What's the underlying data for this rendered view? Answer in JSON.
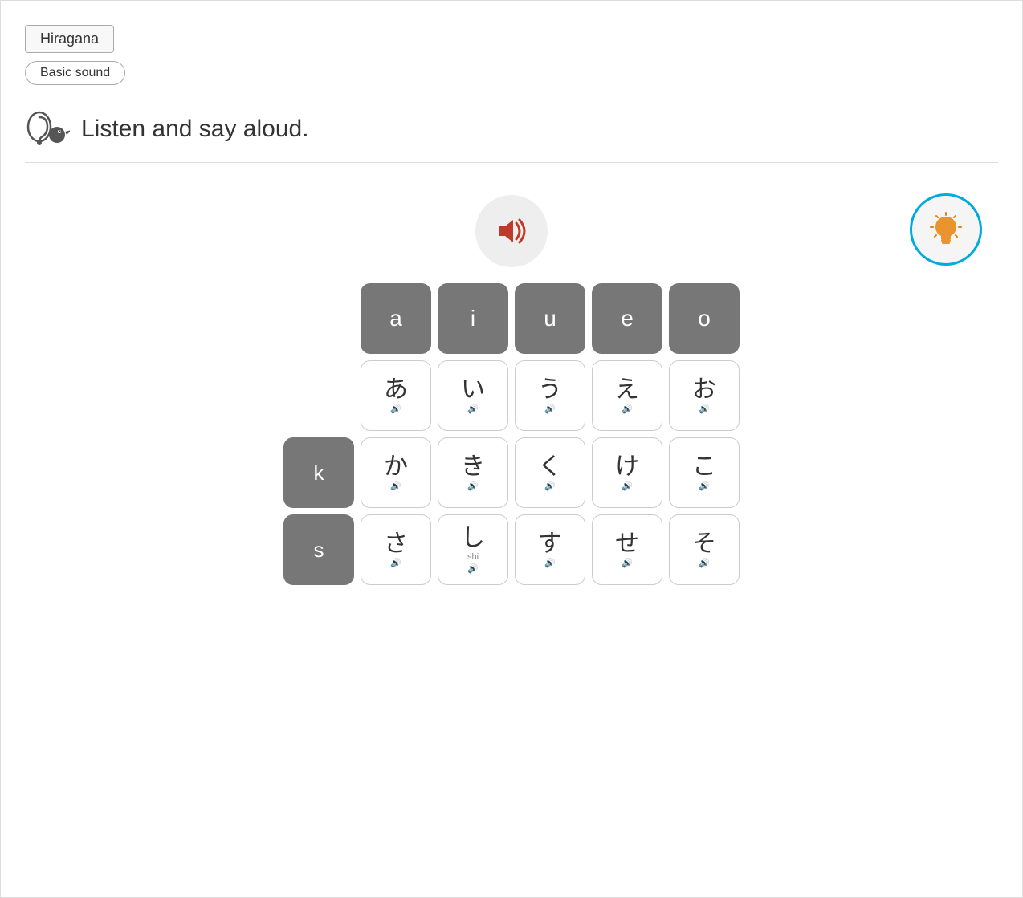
{
  "header": {
    "hiragana_label": "Hiragana",
    "basic_sound_label": "Basic sound"
  },
  "listen": {
    "text": "Listen and say aloud."
  },
  "hint_button": {
    "label": "hint"
  },
  "keyboard": {
    "vowel_row": [
      "a",
      "i",
      "u",
      "e",
      "o"
    ],
    "rows": [
      {
        "label": "",
        "label_empty": true,
        "chars": [
          {
            "main": "あ",
            "sub": "",
            "romaji": ""
          },
          {
            "main": "い",
            "sub": "",
            "romaji": ""
          },
          {
            "main": "う",
            "sub": "",
            "romaji": ""
          },
          {
            "main": "え",
            "sub": "",
            "romaji": ""
          },
          {
            "main": "お",
            "sub": "",
            "romaji": ""
          }
        ]
      },
      {
        "label": "k",
        "label_empty": false,
        "chars": [
          {
            "main": "か",
            "sub": "",
            "romaji": ""
          },
          {
            "main": "き",
            "sub": "",
            "romaji": ""
          },
          {
            "main": "く",
            "sub": "",
            "romaji": ""
          },
          {
            "main": "け",
            "sub": "",
            "romaji": ""
          },
          {
            "main": "こ",
            "sub": "",
            "romaji": ""
          }
        ]
      },
      {
        "label": "s",
        "label_empty": false,
        "chars": [
          {
            "main": "さ",
            "sub": "",
            "romaji": ""
          },
          {
            "main": "し",
            "sub": "shi",
            "romaji": "shi"
          },
          {
            "main": "す",
            "sub": "",
            "romaji": ""
          },
          {
            "main": "せ",
            "sub": "",
            "romaji": ""
          },
          {
            "main": "そ",
            "sub": "",
            "romaji": ""
          }
        ]
      }
    ]
  }
}
